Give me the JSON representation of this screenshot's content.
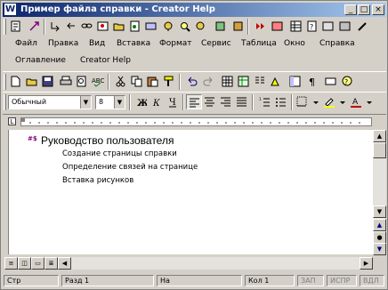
{
  "window": {
    "title": "Пример файла справки - Creator Help",
    "app_icon": "W",
    "minimize_glyph": "_",
    "maximize_glyph": "□",
    "close_glyph": "×"
  },
  "menubar": {
    "items": [
      "Файл",
      "Правка",
      "Вид",
      "Вставка",
      "Формат",
      "Сервис",
      "Таблица",
      "Окно",
      "Справка"
    ]
  },
  "menubar2": {
    "items": [
      "Оглавление",
      "Creator Help"
    ]
  },
  "formatting": {
    "style": "Обычный",
    "size": "8"
  },
  "document": {
    "heading_marker": "#$",
    "heading": "Руководство пользователя",
    "lines": [
      "Создание страницы справки",
      "Определение связей на странице",
      "Вставка рисунков"
    ]
  },
  "statusbar": {
    "page": "Стр",
    "section": "Разд 1",
    "at": "На",
    "col": "Кол 1",
    "rec": "ЗАП",
    "trk": "ИСПР",
    "ext": "ВДЛ"
  }
}
